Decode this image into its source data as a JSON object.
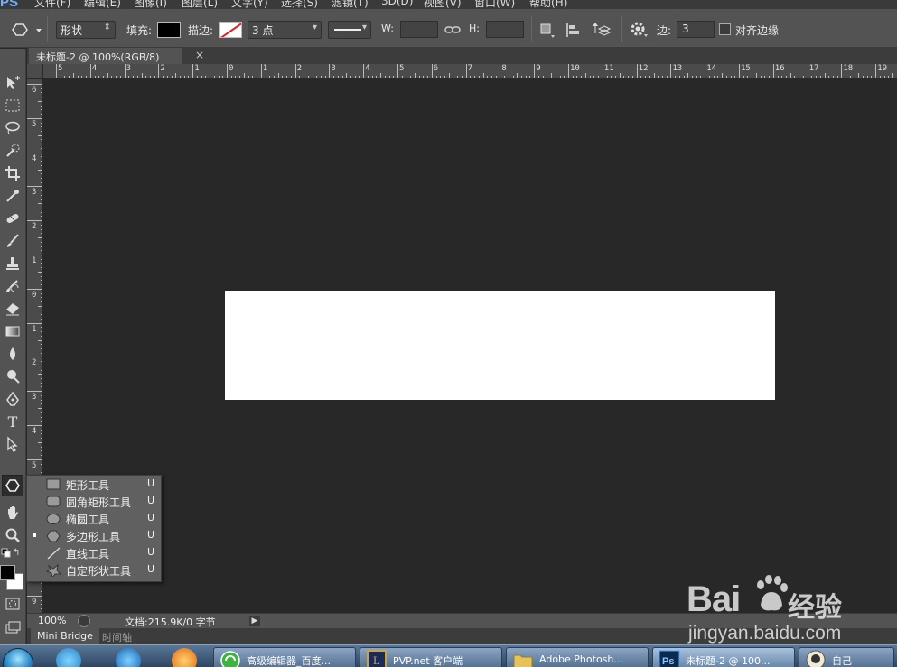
{
  "app": {
    "logo": "PS"
  },
  "menu": [
    "文件(F)",
    "编辑(E)",
    "图像(I)",
    "图层(L)",
    "文字(Y)",
    "选择(S)",
    "滤镜(T)",
    "3D(D)",
    "视图(V)",
    "窗口(W)",
    "帮助(H)"
  ],
  "options": {
    "mode": "形状",
    "fill_label": "填充:",
    "fill_color": "#000000",
    "stroke_label": "描边:",
    "stroke_width": "3 点",
    "w_label": "W:",
    "w_value": "",
    "h_label": "H:",
    "h_value": "",
    "sides_label": "边:",
    "sides_value": "3",
    "align_edges_label": "对齐边缘"
  },
  "document": {
    "tab_title": "未标题-2 @ 100%(RGB/8)",
    "close": "×",
    "shape_color": "#ffffff",
    "canvas_color": "#282828"
  },
  "ruler_h_labels": [
    "5",
    "4",
    "3",
    "2",
    "1",
    "0",
    "1",
    "2",
    "3",
    "4",
    "5",
    "6",
    "7",
    "8",
    "9",
    "10",
    "11",
    "12",
    "13",
    "14",
    "15",
    "16",
    "17",
    "18",
    "19"
  ],
  "ruler_v_labels": [
    "6",
    "5",
    "4",
    "3",
    "2",
    "1",
    "0",
    "1",
    "2",
    "3",
    "4",
    "5",
    "6",
    "7",
    "8",
    "9"
  ],
  "flyout": {
    "items": [
      {
        "label": "矩形工具",
        "shortcut": "U",
        "icon": "rectangle-icon",
        "selected": false
      },
      {
        "label": "圆角矩形工具",
        "shortcut": "U",
        "icon": "rounded-rectangle-icon",
        "selected": false
      },
      {
        "label": "椭圆工具",
        "shortcut": "U",
        "icon": "ellipse-icon",
        "selected": false
      },
      {
        "label": "多边形工具",
        "shortcut": "U",
        "icon": "polygon-icon",
        "selected": true
      },
      {
        "label": "直线工具",
        "shortcut": "U",
        "icon": "line-icon",
        "selected": false
      },
      {
        "label": "自定形状工具",
        "shortcut": "U",
        "icon": "custom-shape-icon",
        "selected": false
      }
    ]
  },
  "status": {
    "zoom": "100%",
    "doc_info": "文档:215.9K/0 字节",
    "arrow": "▶"
  },
  "panels": {
    "tab_active": "Mini Bridge",
    "tab_inactive": "时间轴"
  },
  "taskbar": {
    "buttons": [
      {
        "label": "高级编辑器_百度...",
        "icon": "refresh-icon"
      },
      {
        "label": "PVP.net 客户端",
        "icon": "game-icon"
      },
      {
        "label": "Adobe Photosh...",
        "icon": "folder-icon"
      },
      {
        "label": "未标题-2 @ 100...",
        "icon": "photoshop-icon"
      },
      {
        "label": "自己",
        "icon": "avatar-icon"
      }
    ]
  },
  "watermark": {
    "brand": "Bai",
    "brand_cn": "经验",
    "url": "jingyan.baidu.com"
  },
  "colors": {
    "chrome": "#535353",
    "canvas": "#282828",
    "accent": "#6fb3ff"
  }
}
